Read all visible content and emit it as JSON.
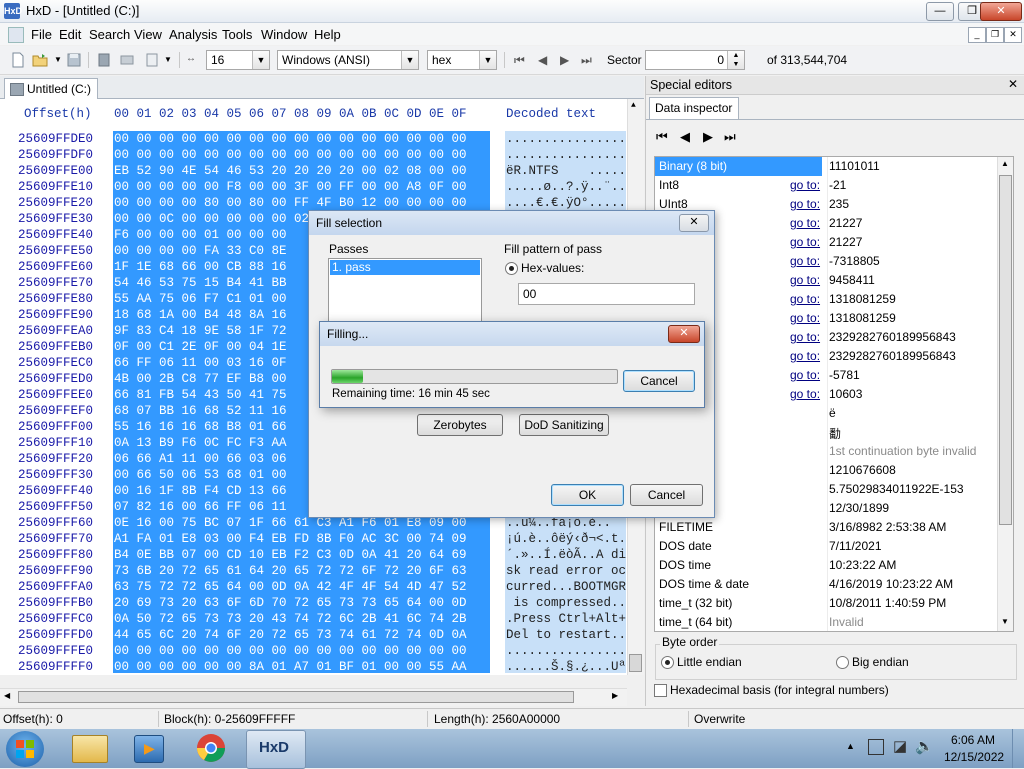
{
  "window": {
    "title": "HxD - [Untitled (C:)]",
    "app_icon": "HxD"
  },
  "menu": [
    "File",
    "Edit",
    "Search",
    "View",
    "Analysis",
    "Tools",
    "Window",
    "Help"
  ],
  "toolbar": {
    "bytes_per_row": "16",
    "charset": "Windows (ANSI)",
    "offset_base": "hex",
    "sector_label": "Sector",
    "sector_value": "0",
    "sector_total": "of 313,544,704"
  },
  "doc_tab": "Untitled (C:)",
  "hex_header": {
    "offset": "Offset(h)",
    "columns": "00 01 02 03 04 05 06 07 08 09 0A 0B 0C 0D 0E 0F",
    "decoded": "Decoded text"
  },
  "rows": [
    {
      "off": "25609FFDE0",
      "hex": "00 00 00 00 00 00 00 00 00 00 00 00 00 00 00 00",
      "dec": "................"
    },
    {
      "off": "25609FFDF0",
      "hex": "00 00 00 00 00 00 00 00 00 00 00 00 00 00 00 00",
      "dec": "................"
    },
    {
      "off": "25609FFE00",
      "hex": "EB 52 90 4E 54 46 53 20 20 20 20 00 02 08 00 00",
      "dec": "ëR.NTFS    ....."
    },
    {
      "off": "25609FFE10",
      "hex": "00 00 00 00 00 F8 00 00 3F 00 FF 00 00 A8 0F 00",
      "dec": ".....ø..?.ÿ..¨.."
    },
    {
      "off": "25609FFE20",
      "hex": "00 00 00 00 80 00 80 00 FF 4F B0 12 00 00 00 00",
      "dec": "....€.€.ÿO°....."
    },
    {
      "off": "25609FFE30",
      "hex": "00 00 0C 00 00 00 00 00 02 00 00 00 00 00 00 00",
      "dec": "................"
    },
    {
      "off": "25609FFE40",
      "hex": "F6 00 00 00 01 00 00 00",
      "dec": ""
    },
    {
      "off": "25609FFE50",
      "hex": "00 00 00 00 FA 33 C0 8E",
      "dec": ""
    },
    {
      "off": "25609FFE60",
      "hex": "1F 1E 68 66 00 CB 88 16",
      "dec": ""
    },
    {
      "off": "25609FFE70",
      "hex": "54 46 53 75 15 B4 41 BB",
      "dec": ""
    },
    {
      "off": "25609FFE80",
      "hex": "55 AA 75 06 F7 C1 01 00",
      "dec": ""
    },
    {
      "off": "25609FFE90",
      "hex": "18 68 1A 00 B4 48 8A 16",
      "dec": ""
    },
    {
      "off": "25609FFEA0",
      "hex": "9F 83 C4 18 9E 58 1F 72",
      "dec": ""
    },
    {
      "off": "25609FFEB0",
      "hex": "0F 00 C1 2E 0F 00 04 1E",
      "dec": ""
    },
    {
      "off": "25609FFEC0",
      "hex": "66 FF 06 11 00 03 16 0F",
      "dec": ""
    },
    {
      "off": "25609FFED0",
      "hex": "4B 00 2B C8 77 EF B8 00",
      "dec": ""
    },
    {
      "off": "25609FFEE0",
      "hex": "66 81 FB 54 43 50 41 75",
      "dec": ""
    },
    {
      "off": "25609FFEF0",
      "hex": "68 07 BB 16 68 52 11 16",
      "dec": ""
    },
    {
      "off": "25609FFF00",
      "hex": "55 16 16 16 68 B8 01 66",
      "dec": ""
    },
    {
      "off": "25609FFF10",
      "hex": "0A 13 B9 F6 0C FC F3 AA",
      "dec": ""
    },
    {
      "off": "25609FFF20",
      "hex": "06 66 A1 11 00 66 03 06",
      "dec": ""
    },
    {
      "off": "25609FFF30",
      "hex": "00 66 50 06 53 68 01 00",
      "dec": ""
    },
    {
      "off": "25609FFF40",
      "hex": "00 16 1F 8B F4 CD 13 66",
      "dec": ""
    },
    {
      "off": "25609FFF50",
      "hex": "07 82 16 00 66 FF 06 11",
      "dec": ""
    },
    {
      "off": "25609FFF60",
      "hex": "0E 16 00 75 BC 07 1F 66 61 C3 A1 F6 01 E8 09 00",
      "dec": "..u¼..fa¡ö.è.."
    },
    {
      "off": "25609FFF70",
      "hex": "A1 FA 01 E8 03 00 F4 EB FD 8B F0 AC 3C 00 74 09",
      "dec": "¡ú.è..ôëý‹ð¬<.t."
    },
    {
      "off": "25609FFF80",
      "hex": "B4 0E BB 07 00 CD 10 EB F2 C3 0D 0A 41 20 64 69",
      "dec": "´.»..Í.ëòÃ..A di"
    },
    {
      "off": "25609FFF90",
      "hex": "73 6B 20 72 65 61 64 20 65 72 72 6F 72 20 6F 63",
      "dec": "sk read error oc"
    },
    {
      "off": "25609FFFA0",
      "hex": "63 75 72 72 65 64 00 0D 0A 42 4F 4F 54 4D 47 52",
      "dec": "curred...BOOTMGR"
    },
    {
      "off": "25609FFFB0",
      "hex": "20 69 73 20 63 6F 6D 70 72 65 73 73 65 64 00 0D",
      "dec": " is compressed.."
    },
    {
      "off": "25609FFFC0",
      "hex": "0A 50 72 65 73 73 20 43 74 72 6C 2B 41 6C 74 2B",
      "dec": ".Press Ctrl+Alt+"
    },
    {
      "off": "25609FFFD0",
      "hex": "44 65 6C 20 74 6F 20 72 65 73 74 61 72 74 0D 0A",
      "dec": "Del to restart.."
    },
    {
      "off": "25609FFFE0",
      "hex": "00 00 00 00 00 00 00 00 00 00 00 00 00 00 00 00",
      "dec": "................"
    },
    {
      "off": "25609FFFF0",
      "hex": "00 00 00 00 00 00 8A 01 A7 01 BF 01 00 00 55 AA",
      "dec": "......Š.§.¿...Uª"
    }
  ],
  "special_editors": {
    "title": "Special editors",
    "tab": "Data inspector",
    "goto": "go to:",
    "rows": [
      {
        "name": "Binary (8 bit)",
        "val": "11101011",
        "goto": false,
        "sel": true
      },
      {
        "name": "Int8",
        "val": "-21",
        "goto": true
      },
      {
        "name": "UInt8",
        "val": "235",
        "goto": true
      },
      {
        "name": "",
        "val": "21227",
        "goto": true
      },
      {
        "name": "",
        "val": "21227",
        "goto": true
      },
      {
        "name": "",
        "val": "-7318805",
        "goto": true
      },
      {
        "name": "",
        "val": "9458411",
        "goto": true
      },
      {
        "name": "",
        "val": "1318081259",
        "goto": true
      },
      {
        "name": "",
        "val": "1318081259",
        "goto": true
      },
      {
        "name": "",
        "val": "2329282760189956843",
        "goto": true
      },
      {
        "name": "",
        "val": "2329282760189956843",
        "goto": true
      },
      {
        "name": "",
        "val": "-5781",
        "goto": true
      },
      {
        "name": "",
        "val": "10603",
        "goto": true
      },
      {
        "name": "char8_t",
        "val": "ë",
        "goto": false
      },
      {
        "name": "char16_t",
        "val": "勫",
        "goto": false
      },
      {
        "name": "e point",
        "val": "1st continuation byte invalid",
        "goto": false,
        "dim": true
      },
      {
        "name": "at32)",
        "val": "1210676608",
        "goto": false
      },
      {
        "name": "at64)",
        "val": "5.75029834011922E-153",
        "goto": false
      },
      {
        "name": "",
        "val": "12/30/1899",
        "goto": false
      },
      {
        "name": "FILETIME",
        "val": "3/16/8982 2:53:38 AM",
        "goto": false
      },
      {
        "name": "DOS date",
        "val": "7/11/2021",
        "goto": false
      },
      {
        "name": "DOS time",
        "val": "10:23:22 AM",
        "goto": false
      },
      {
        "name": "DOS time & date",
        "val": "4/16/2019 10:23:22 AM",
        "goto": false
      },
      {
        "name": "time_t (32 bit)",
        "val": "10/8/2011 1:40:59 PM",
        "goto": false
      },
      {
        "name": "time_t (64 bit)",
        "val": "Invalid",
        "goto": false,
        "dim": true
      }
    ],
    "byte_order_label": "Byte order",
    "little_endian": "Little endian",
    "big_endian": "Big endian",
    "hex_basis": "Hexadecimal basis (for integral numbers)"
  },
  "status": {
    "offset": "Offset(h): 0",
    "block": "Block(h): 0-25609FFFFF",
    "length": "Length(h): 2560A00000",
    "mode": "Overwrite"
  },
  "fill_dialog": {
    "title": "Fill selection",
    "passes_label": "Passes",
    "pass_item": "1. pass",
    "pattern_label": "Fill pattern of pass",
    "hex_values_label": "Hex-values:",
    "hex_value": "00",
    "zerobytes": "Zerobytes",
    "dod": "DoD Sanitizing",
    "ok": "OK",
    "cancel": "Cancel"
  },
  "filling_dialog": {
    "title": "Filling...",
    "progress_fraction": 0.11,
    "remaining": "Remaining time: 16 min 45 sec",
    "cancel": "Cancel"
  },
  "taskbar": {
    "time": "6:06 AM",
    "date": "12/15/2022"
  }
}
